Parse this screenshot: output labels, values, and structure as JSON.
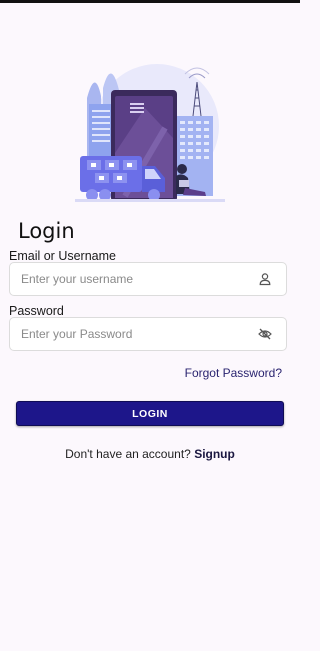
{
  "header": {
    "title": "Login"
  },
  "form": {
    "username": {
      "label": "Email or Username",
      "placeholder": "Enter your username",
      "icon": "user-icon"
    },
    "password": {
      "label": "Password",
      "placeholder": "Enter your Password",
      "icon": "eye-off-icon"
    },
    "forgot_label": "Forgot Password?",
    "login_label": "LOGIN"
  },
  "footer": {
    "prompt": "Don't have an account?",
    "signup_label": "Signup"
  },
  "colors": {
    "background": "#fcf8fd",
    "primary": "#1d168a",
    "link": "#2a2470",
    "illustration_accent": "#6b6fe8"
  }
}
